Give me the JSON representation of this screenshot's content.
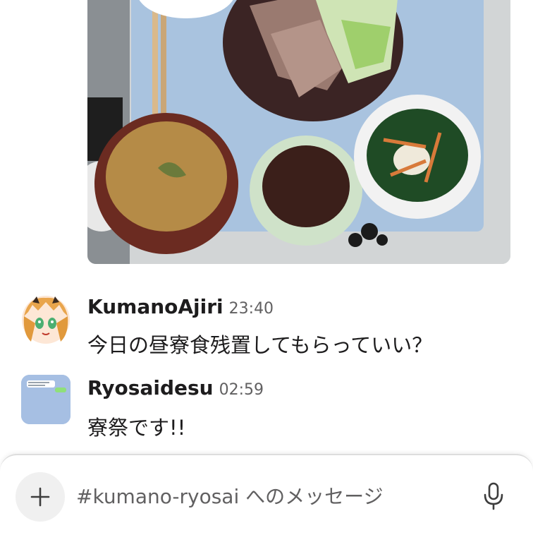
{
  "messages": [
    {
      "user": "KumanoAjiri",
      "time": "23:40",
      "text": "今日の昼寮食残置してもらっていい？"
    },
    {
      "user": "Ryosaidesu",
      "time": "02:59",
      "text": "寮祭です!!"
    }
  ],
  "composer": {
    "placeholder": "#kumano-ryosai へのメッセージ"
  },
  "colors": {
    "name_text": "#1d1c1d",
    "time_text": "#616061",
    "avatar2_bg": "#a6bfe3",
    "button_bg": "#f0f0f0"
  },
  "icons": [
    "plus-icon",
    "microphone-icon"
  ]
}
